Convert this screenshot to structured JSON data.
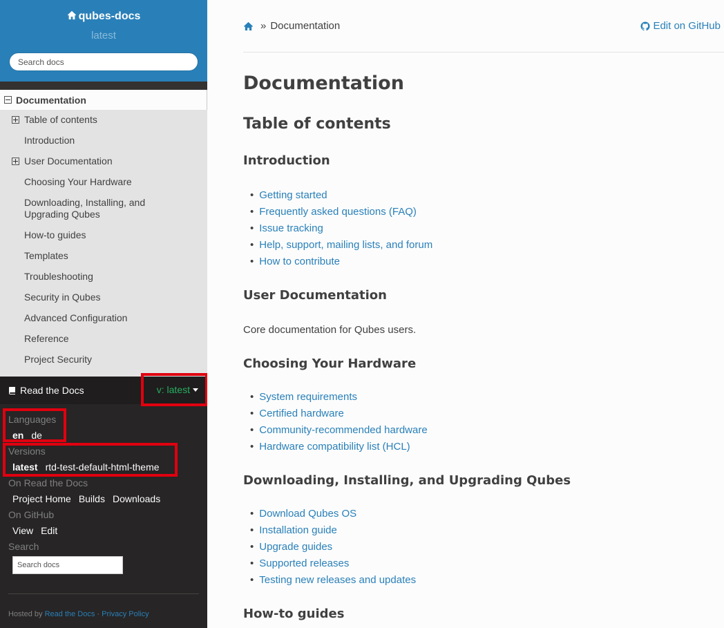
{
  "sidebar": {
    "project_name": "qubes-docs",
    "version": "latest",
    "search_placeholder": "Search docs",
    "current": "Documentation",
    "items": [
      {
        "label": "Table of contents",
        "expandable": true
      },
      {
        "label": "Introduction",
        "expandable": false
      },
      {
        "label": "User Documentation",
        "expandable": true
      },
      {
        "label": "Choosing Your Hardware",
        "expandable": false
      },
      {
        "label": "Downloading, Installing, and Upgrading Qubes",
        "expandable": false
      },
      {
        "label": "How-to guides",
        "expandable": false
      },
      {
        "label": "Templates",
        "expandable": false
      },
      {
        "label": "Troubleshooting",
        "expandable": false
      },
      {
        "label": "Security in Qubes",
        "expandable": false
      },
      {
        "label": "Advanced Configuration",
        "expandable": false
      },
      {
        "label": "Reference",
        "expandable": false
      },
      {
        "label": "Project Security",
        "expandable": false
      }
    ]
  },
  "rtd": {
    "title": "Read the Docs",
    "version_label": "v: latest",
    "languages_title": "Languages",
    "languages": [
      "en",
      "de"
    ],
    "versions_title": "Versions",
    "versions": [
      "latest",
      "rtd-test-default-html-theme"
    ],
    "on_rtd_title": "On Read the Docs",
    "on_rtd_links": [
      "Project Home",
      "Builds",
      "Downloads"
    ],
    "github_title": "On GitHub",
    "github_links": [
      "View",
      "Edit"
    ],
    "search_title": "Search",
    "search_placeholder": "Search docs",
    "hosted_prefix": "Hosted by",
    "hosted_link": "Read the Docs",
    "separator": "·",
    "privacy": "Privacy Policy"
  },
  "content": {
    "breadcrumb_sep": "»",
    "breadcrumb_current": "Documentation",
    "edit_label": "Edit on GitHub",
    "h1": "Documentation",
    "toc_heading": "Table of contents",
    "sections": {
      "intro": {
        "title": "Introduction",
        "links": [
          "Getting started",
          "Frequently asked questions (FAQ)",
          "Issue tracking",
          "Help, support, mailing lists, and forum",
          "How to contribute"
        ]
      },
      "user": {
        "title": "User Documentation",
        "text": "Core documentation for Qubes users."
      },
      "hardware": {
        "title": "Choosing Your Hardware",
        "links": [
          "System requirements",
          "Certified hardware",
          "Community-recommended hardware",
          "Hardware compatibility list (HCL)"
        ]
      },
      "install": {
        "title": "Downloading, Installing, and Upgrading Qubes",
        "links": [
          "Download Qubes OS",
          "Installation guide",
          "Upgrade guides",
          "Supported releases",
          "Testing new releases and updates"
        ]
      },
      "howto": {
        "title": "How-to guides"
      }
    }
  }
}
